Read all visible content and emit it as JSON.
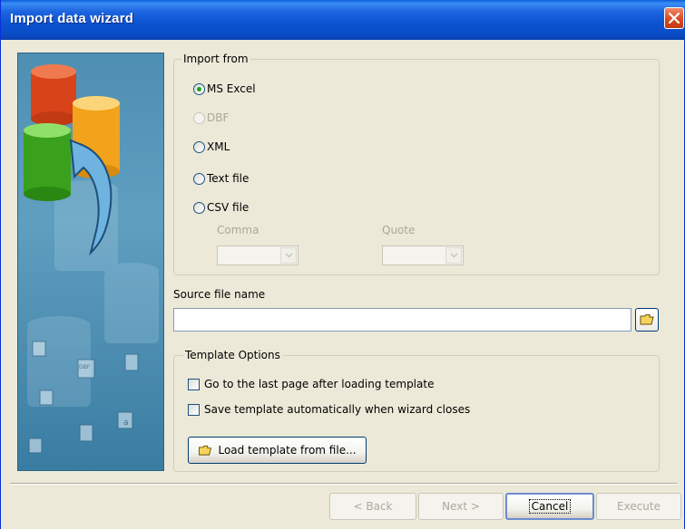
{
  "window": {
    "title": "Import data wizard"
  },
  "import_from": {
    "label": "Import from",
    "options": [
      {
        "label": "MS Excel",
        "checked": true,
        "enabled": true
      },
      {
        "label": "DBF",
        "checked": false,
        "enabled": false
      },
      {
        "label": "XML",
        "checked": false,
        "enabled": true
      },
      {
        "label": "Text file",
        "checked": false,
        "enabled": true
      },
      {
        "label": "CSV file",
        "checked": false,
        "enabled": true
      }
    ],
    "comma_label": "Comma",
    "comma_value": "",
    "quote_label": "Quote",
    "quote_value": ""
  },
  "source": {
    "label": "Source file name",
    "value": ""
  },
  "template": {
    "label": "Template Options",
    "goto_last": "Go to the last page after loading template",
    "save_auto": "Save template automatically when wizard closes",
    "load_button": "Load template from file..."
  },
  "buttons": {
    "back": "< Back",
    "next": "Next >",
    "cancel": "Cancel",
    "execute": "Execute"
  },
  "colors": {
    "selected_radio": "#21a121",
    "titlebar": "#0a4cc6",
    "banner": "#4e8fb2"
  },
  "icons": {
    "close": "close-icon",
    "folder": "folder-icon",
    "database": "database-illustration"
  }
}
